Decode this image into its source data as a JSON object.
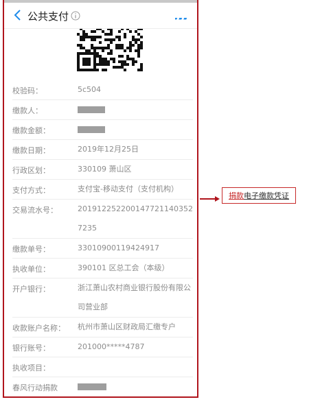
{
  "header": {
    "title": "公共支付",
    "colors": {
      "accent": "#1f8ceb",
      "border": "#b0141c"
    }
  },
  "rows": [
    {
      "label": "校验码：",
      "value": "5c504"
    },
    {
      "label": "缴款人：",
      "value": ""
    },
    {
      "label": "缴款金额：",
      "value": ""
    },
    {
      "label": "缴款日期：",
      "value": "2019年12月25日"
    },
    {
      "label": "行政区划：",
      "value": "330109 萧山区"
    },
    {
      "label": "支付方式：",
      "value": "支付宝-移动支付（支付机构）"
    },
    {
      "label": "交易流水号：",
      "value": "2019122522001477211403527235"
    },
    {
      "label": "缴款单号：",
      "value": "33010900119424917"
    },
    {
      "label": "执收单位：",
      "value": "390101 区总工会（本级）"
    },
    {
      "label": "开户银行：",
      "value": "浙江萧山农村商业银行股份有限公司营业部"
    },
    {
      "label": "收款账户名称：",
      "value": "杭州市萧山区财政局汇缴专户"
    },
    {
      "label": "银行账号：",
      "value": "201000*****4787"
    },
    {
      "label": "执收项目：",
      "value": ""
    },
    {
      "label": "春风行动捐款",
      "value": ""
    }
  ],
  "callout": {
    "part1": "捐款",
    "part2": "电子缴款凭证",
    "color": "#c62828"
  }
}
